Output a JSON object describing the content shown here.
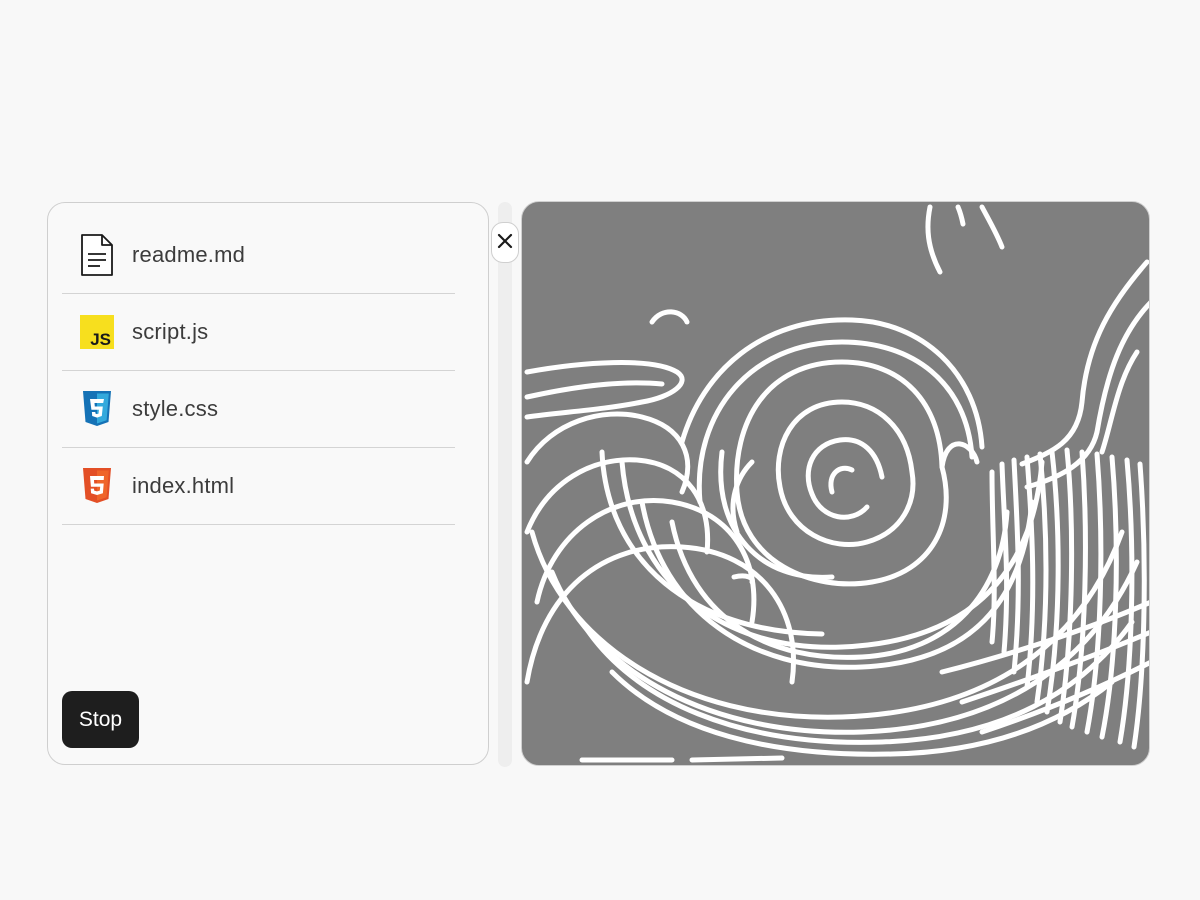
{
  "files": [
    {
      "name": "readme.md",
      "icon": "document-icon"
    },
    {
      "name": "script.js",
      "icon": "javascript-icon"
    },
    {
      "name": "style.css",
      "icon": "css3-icon"
    },
    {
      "name": "index.html",
      "icon": "html5-icon"
    }
  ],
  "stop_button": {
    "label": "Stop"
  },
  "close_button": {
    "icon": "close-icon"
  },
  "canvas": {
    "background": "#7f7f7f",
    "stroke": "#ffffff"
  },
  "colors": {
    "js_yellow": "#f7df1e",
    "css_blue": "#1572b6",
    "html_orange": "#e34f26"
  }
}
